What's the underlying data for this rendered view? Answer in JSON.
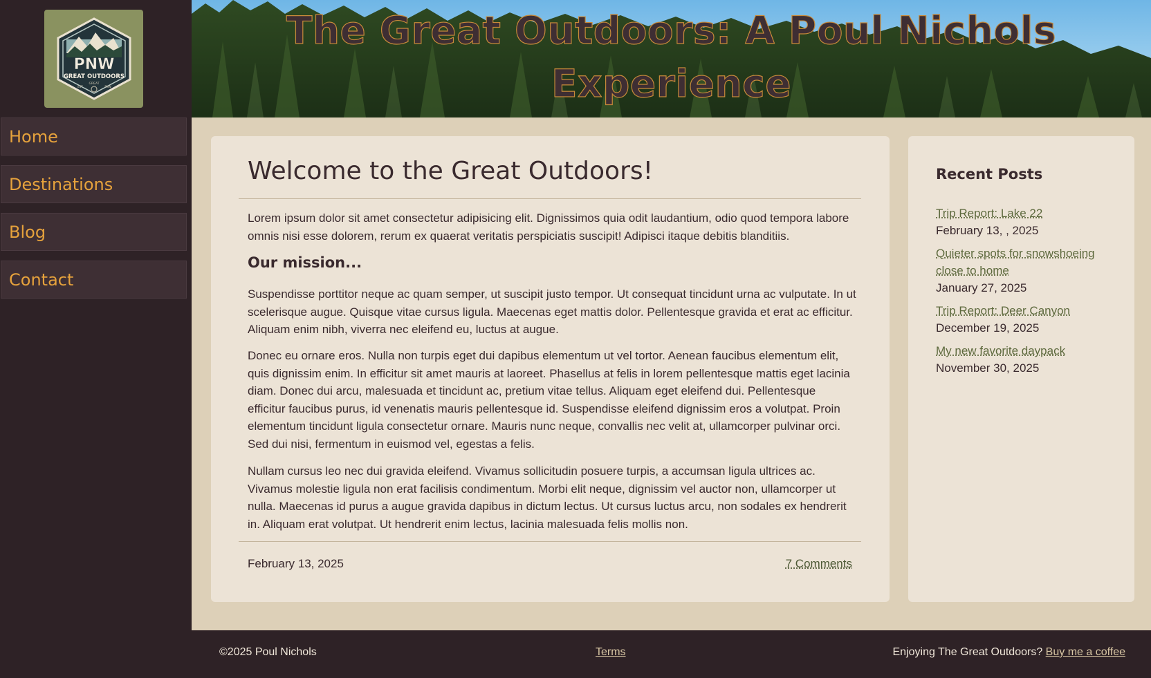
{
  "site": {
    "title": "The Great Outdoors: A Poul Nichols Experience",
    "logo": {
      "main": "PNW",
      "sub": "GREAT OUTDOORS",
      "small": "GREAT",
      "est_left": "EST",
      "est_right": "PNW"
    }
  },
  "nav": {
    "items": [
      {
        "label": "Home"
      },
      {
        "label": "Destinations"
      },
      {
        "label": "Blog"
      },
      {
        "label": "Contact"
      }
    ]
  },
  "article": {
    "title": "Welcome to the Great Outdoors!",
    "intro": "Lorem ipsum dolor sit amet consectetur adipisicing elit. Dignissimos quia odit laudantium, odio quod tempora labore omnis nisi esse dolorem, rerum ex quaerat veritatis perspiciatis suscipit! Adipisci itaque debitis blanditiis.",
    "mission_heading": "Our mission...",
    "paragraphs": [
      "Suspendisse porttitor neque ac quam semper, ut suscipit justo tempor. Ut consequat tincidunt urna ac vulputate. In ut scelerisque augue. Quisque vitae cursus ligula. Maecenas eget mattis dolor. Pellentesque gravida et erat ac efficitur. Aliquam enim nibh, viverra nec eleifend eu, luctus at augue.",
      "Donec eu ornare eros. Nulla non turpis eget dui dapibus elementum ut vel tortor. Aenean faucibus elementum elit, quis dignissim enim. In efficitur sit amet mauris at laoreet. Phasellus at felis in lorem pellentesque mattis eget lacinia diam. Donec dui arcu, malesuada et tincidunt ac, pretium vitae tellus. Aliquam eget eleifend dui. Pellentesque efficitur faucibus purus, id venenatis mauris pellentesque id. Suspendisse eleifend dignissim eros a volutpat. Proin elementum tincidunt ligula consectetur ornare. Mauris nunc neque, convallis nec velit at, ullamcorper pulvinar orci. Sed dui nisi, fermentum in euismod vel, egestas a felis.",
      "Nullam cursus leo nec dui gravida eleifend. Vivamus sollicitudin posuere turpis, a accumsan ligula ultrices ac. Vivamus molestie ligula non erat facilisis condimentum. Morbi elit neque, dignissim vel auctor non, ullamcorper ut nulla. Maecenas id purus a augue gravida dapibus in dictum lectus. Ut cursus luctus arcu, non sodales ex hendrerit in. Aliquam erat volutpat. Ut hendrerit enim lectus, lacinia malesuada felis mollis non."
    ],
    "date": "February 13, 2025",
    "comments": "7 Comments"
  },
  "recent": {
    "heading": "Recent Posts",
    "posts": [
      {
        "title": "Trip Report: Lake 22",
        "date": "February 13, , 2025"
      },
      {
        "title": "Quieter spots for snowshoeing close to home",
        "date": "January 27, 2025"
      },
      {
        "title": "Trip Report: Deer Canyon",
        "date": "December 19, 2025"
      },
      {
        "title": "My new favorite daypack",
        "date": "November 30, 2025"
      }
    ]
  },
  "footer": {
    "copyright": "©2025 Poul Nichols",
    "terms": "Terms",
    "enjoy": "Enjoying The Great Outdoors?",
    "coffee": "Buy me a coffee"
  },
  "colors": {
    "sidebar_bg": "#2e2226",
    "nav_text": "#e6a23c",
    "content_bg": "#ddd0b8",
    "card_bg": "#ece3d6",
    "link": "#5e6a3e"
  }
}
